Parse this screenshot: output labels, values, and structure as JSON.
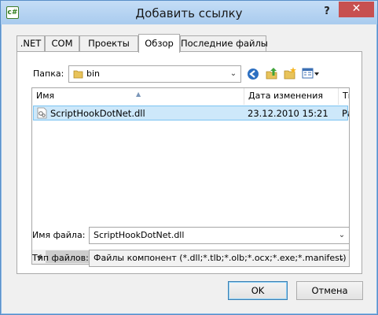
{
  "window": {
    "title": "Добавить ссылку",
    "app_icon_text": "c#",
    "help": "?",
    "close": "✕"
  },
  "tabs": [
    {
      "label": ".NET"
    },
    {
      "label": "COM"
    },
    {
      "label": "Проекты"
    },
    {
      "label": "Обзор",
      "active": true
    },
    {
      "label": "Последние файлы"
    }
  ],
  "browse": {
    "folder_label": "Папка:",
    "folder_value": "bin",
    "toolbar_icons": [
      "back-icon",
      "up-folder-icon",
      "new-folder-icon",
      "view-menu-icon"
    ],
    "columns": [
      "Имя",
      "Дата изменения",
      "Ти"
    ],
    "files": [
      {
        "name": "ScriptHookDotNet.dll",
        "modified": "23.12.2010 15:21",
        "type": "Ра"
      }
    ],
    "filename_label": "Имя файла:",
    "filename_value": "ScriptHookDotNet.dll",
    "filetype_label": "Тип файлов:",
    "filetype_value": "Файлы компонент (*.dll;*.tlb;*.olb;*.ocx;*.exe;*.manifest)"
  },
  "buttons": {
    "ok": "OK",
    "cancel": "Отмена"
  },
  "colors": {
    "titlebar": "#a9cbee",
    "selection": "#cde8fa",
    "close": "#c75050"
  }
}
